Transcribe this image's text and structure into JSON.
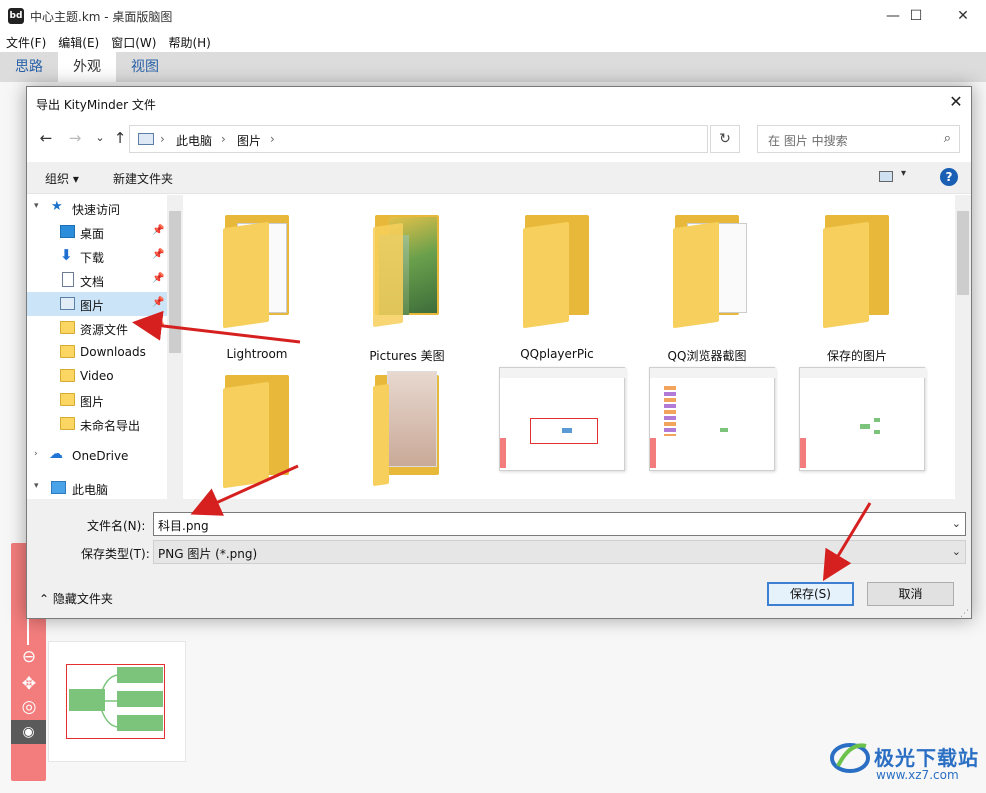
{
  "window": {
    "title": "中心主题.km - 桌面版脑图",
    "minimize": "—",
    "maximize": "☐",
    "close": "✕"
  },
  "menu": [
    "文件(F)",
    "编辑(E)",
    "窗口(W)",
    "帮助(H)"
  ],
  "ribbon_tabs": [
    {
      "label": "思路",
      "active": false
    },
    {
      "label": "外观",
      "active": true
    },
    {
      "label": "视图",
      "active": false
    }
  ],
  "dialog": {
    "title": "导出 KityMinder 文件",
    "close": "✕",
    "nav": {
      "back": "←",
      "forward": "→",
      "recent": "⌄",
      "up": "↑"
    },
    "breadcrumb": [
      "此电脑",
      "图片"
    ],
    "breadcrumb_sep": "›",
    "refresh": "↻",
    "search_placeholder": "在 图片 中搜索",
    "toolbar": {
      "organize": "组织 ▾",
      "new_folder": "新建文件夹",
      "help": "?"
    },
    "sidebar": [
      {
        "label": "快速访问",
        "icon": "star-icon",
        "level": 0,
        "expanded": true
      },
      {
        "label": "桌面",
        "icon": "desktop-icon",
        "level": 1,
        "pinned": true
      },
      {
        "label": "下载",
        "icon": "download-icon",
        "level": 1,
        "pinned": true
      },
      {
        "label": "文档",
        "icon": "document-icon",
        "level": 1,
        "pinned": true
      },
      {
        "label": "图片",
        "icon": "pictures-icon",
        "level": 1,
        "pinned": true,
        "selected": true
      },
      {
        "label": "资源文件",
        "icon": "folder-icon",
        "level": 1,
        "pinned": true
      },
      {
        "label": "Downloads",
        "icon": "folder-icon",
        "level": 1
      },
      {
        "label": "Video",
        "icon": "folder-icon",
        "level": 1
      },
      {
        "label": "图片",
        "icon": "folder-icon",
        "level": 1
      },
      {
        "label": "未命名导出",
        "icon": "folder-icon",
        "level": 1
      },
      {
        "label": "OneDrive",
        "icon": "cloud-icon",
        "level": 0,
        "expanded": false
      },
      {
        "label": "此电脑",
        "icon": "computer-icon",
        "level": 0,
        "expanded": true
      }
    ],
    "files": [
      {
        "label": "Lightroom",
        "kind": "folder-doc"
      },
      {
        "label": "Pictures 美图",
        "kind": "folder-photo"
      },
      {
        "label": "QQplayerPic",
        "kind": "folder"
      },
      {
        "label": "QQ浏览器截图",
        "kind": "folder-doc"
      },
      {
        "label": "保存的图片",
        "kind": "folder"
      },
      {
        "label": "",
        "kind": "folder"
      },
      {
        "label": "",
        "kind": "folder-photo"
      },
      {
        "label": "",
        "kind": "screenshot"
      },
      {
        "label": "",
        "kind": "screenshot"
      },
      {
        "label": "",
        "kind": "screenshot"
      }
    ],
    "filename_label": "文件名(N):",
    "filename_value": "科目.png",
    "filetype_label": "保存类型(T):",
    "filetype_value": "PNG 图片 (*.png)",
    "hide_folders": "隐藏文件夹",
    "save": "保存(S)",
    "cancel": "取消"
  },
  "zoom_toolbar": [
    "zoom-out-icon",
    "move-icon",
    "locate-icon",
    "eye-icon"
  ],
  "watermark": {
    "name": "极光下载站",
    "url": "www.xz7.com"
  },
  "colors": {
    "accent": "#1a5fb4",
    "selection": "#cce4f7",
    "zoombar": "#f37d7d",
    "folder": "#f7cf5c",
    "node": "#7cc47c",
    "annotation": "#d62020"
  }
}
